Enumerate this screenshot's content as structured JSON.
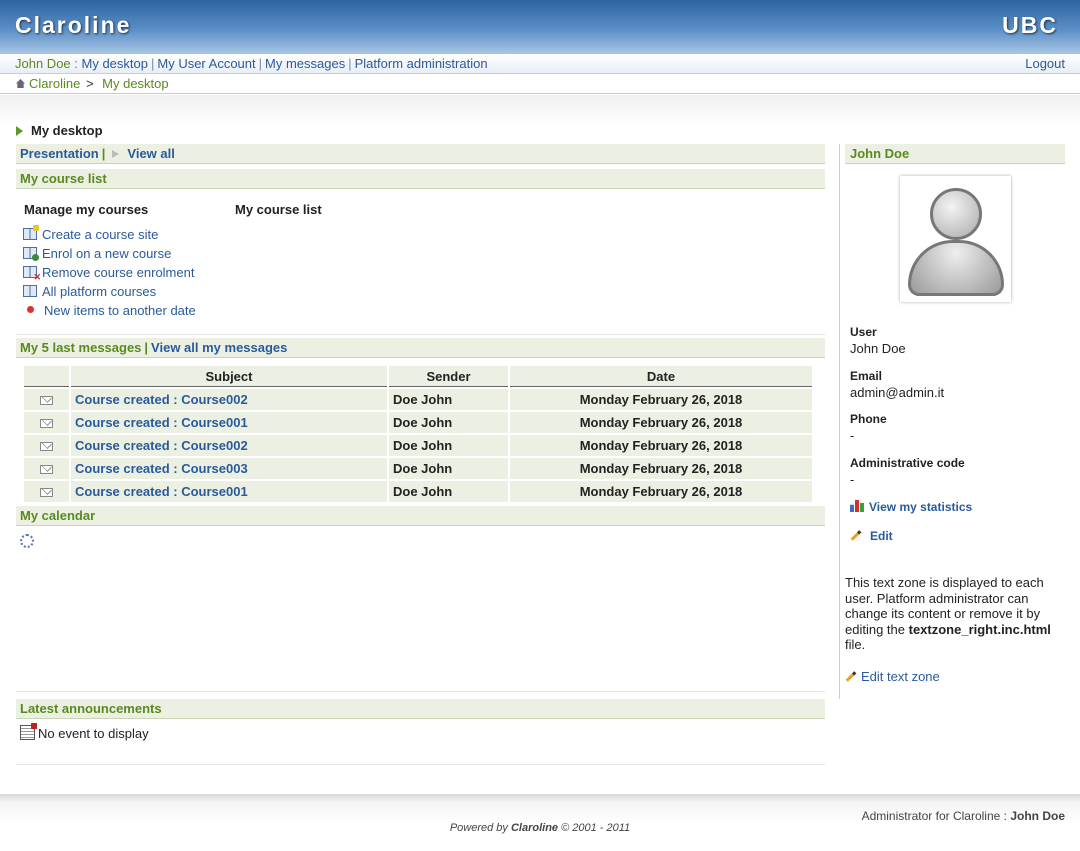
{
  "banner": {
    "brand": "Claroline",
    "institution": "UBC"
  },
  "userbar": {
    "user": "John Doe :",
    "links": [
      "My desktop",
      "My User Account",
      "My messages",
      "Platform administration"
    ],
    "logout": "Logout"
  },
  "breadcrumb": {
    "home": "Claroline",
    "sep": ">",
    "current": "My desktop"
  },
  "page_title": "My desktop",
  "presentation": {
    "label": "Presentation",
    "view_all": "View all"
  },
  "course_list": {
    "title": "My course list",
    "manage_heading": "Manage my courses",
    "list_heading": "My course list",
    "actions": [
      "Create a course site",
      "Enrol on a new course",
      "Remove course enrolment",
      "All platform courses",
      "New items to another date"
    ]
  },
  "messages": {
    "title": "My 5 last messages",
    "view_all": "View all my messages",
    "columns": [
      "Subject",
      "Sender",
      "Date"
    ],
    "rows": [
      {
        "subject": "Course created : Course002",
        "sender": "Doe John",
        "date": "Monday February 26, 2018"
      },
      {
        "subject": "Course created : Course001",
        "sender": "Doe John",
        "date": "Monday February 26, 2018"
      },
      {
        "subject": "Course created : Course002",
        "sender": "Doe John",
        "date": "Monday February 26, 2018"
      },
      {
        "subject": "Course created : Course003",
        "sender": "Doe John",
        "date": "Monday February 26, 2018"
      },
      {
        "subject": "Course created : Course001",
        "sender": "Doe John",
        "date": "Monday February 26, 2018"
      }
    ]
  },
  "calendar": {
    "title": "My calendar"
  },
  "announcements": {
    "title": "Latest announcements",
    "empty": "No event to display"
  },
  "profile": {
    "title": "John Doe",
    "user_label": "User",
    "user_value": "John Doe",
    "email_label": "Email",
    "email_value": "admin@admin.it",
    "phone_label": "Phone",
    "phone_value": "-",
    "admin_code_label": "Administrative code",
    "admin_code_value": "-",
    "stats_link": "View my statistics",
    "edit_link": "Edit"
  },
  "textzone": {
    "text_before": "This text zone is displayed to each user. Platform administrator can change its content or remove it by editing the ",
    "filename": "textzone_right.inc.html",
    "text_after": " file.",
    "edit_link": "Edit text zone"
  },
  "footer": {
    "admin_label": "Administrator for Claroline :",
    "admin_name": "John Doe",
    "powered_prefix": "Powered by ",
    "powered_brand": "Claroline",
    "powered_suffix": " © 2001 - 2011"
  }
}
